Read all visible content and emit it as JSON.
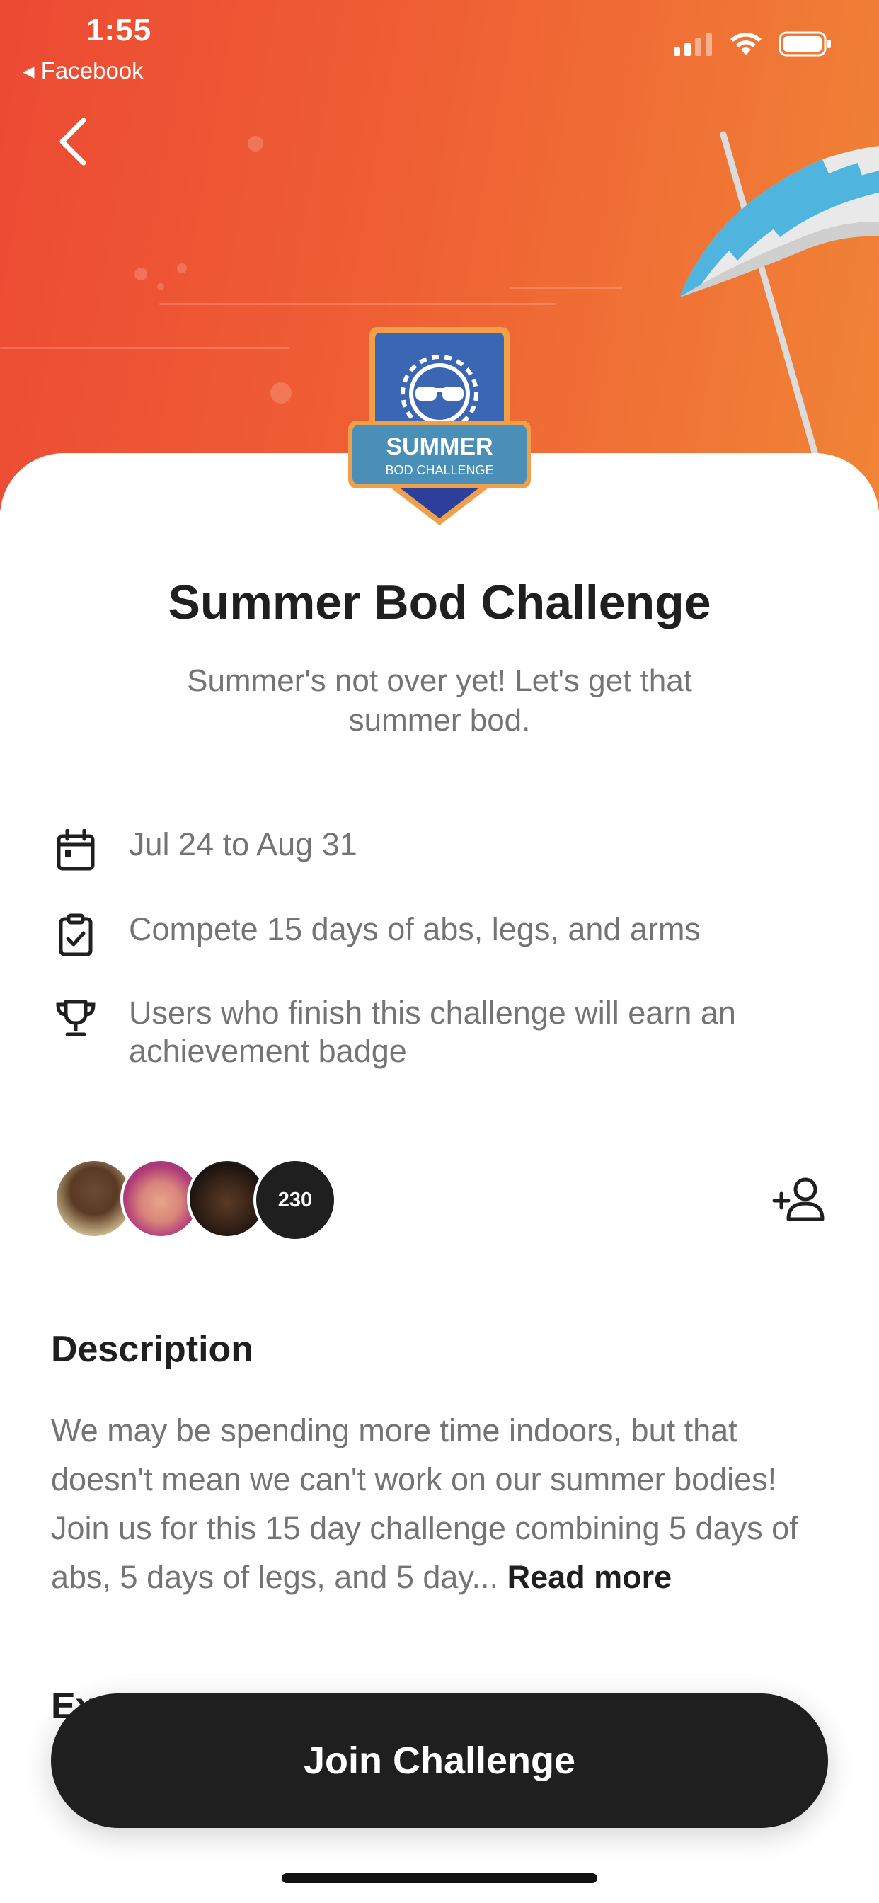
{
  "status_bar": {
    "time": "1:55",
    "back_app": "◂ Facebook"
  },
  "badge": {
    "line1": "SUMMER",
    "line2": "BOD CHALLENGE"
  },
  "challenge": {
    "title": "Summer Bod Challenge",
    "subtitle": "Summer's not over yet! Let's get that summer bod."
  },
  "info": {
    "dates": "Jul 24 to Aug 31",
    "compete": "Compete 15 days of abs, legs, and arms",
    "reward": "Users who finish this challenge will earn an achievement badge"
  },
  "participants": {
    "count": "230"
  },
  "description": {
    "heading": "Description",
    "text": "We may be spending more time indoors, but that doesn't mean we can't work on our summer bodies! Join us for this 15 day challenge combining 5 days of abs, 5 days of legs, and 5 day...",
    "read_more": "Read more"
  },
  "next_section": {
    "heading_partial": "Ex"
  },
  "cta": {
    "join_label": "Join Challenge"
  },
  "colors": {
    "hero_start": "#ec4a33",
    "hero_end": "#f08436",
    "primary_dark": "#1f1f1f",
    "muted_text": "#747474"
  }
}
